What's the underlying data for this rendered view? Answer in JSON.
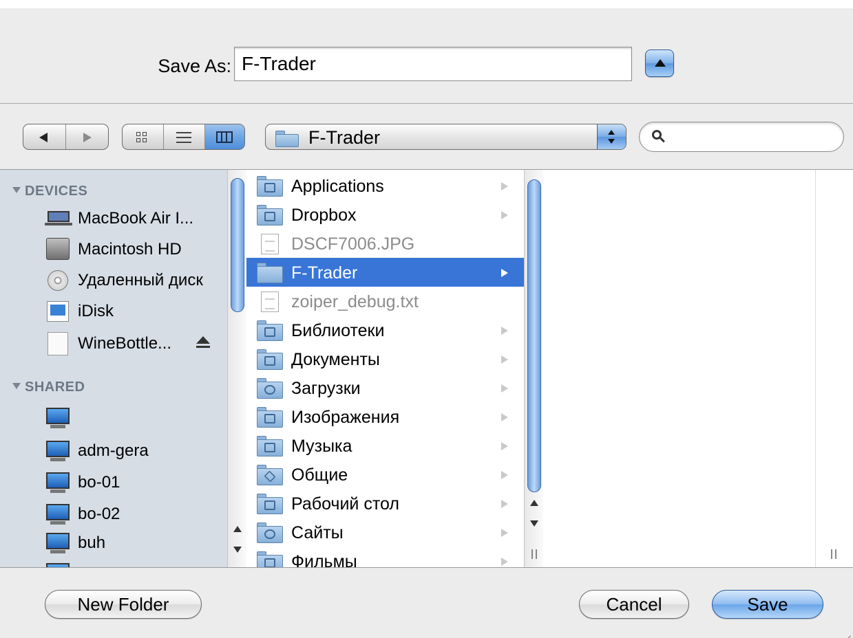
{
  "save_as": {
    "label": "Save As:",
    "value": "F-Trader"
  },
  "toolbar": {
    "back_icon": "back-arrow-icon",
    "forward_icon": "forward-arrow-icon",
    "views": [
      "icon-view-icon",
      "list-view-icon",
      "column-view-icon"
    ],
    "active_view": "column",
    "path": "F-Trader",
    "search_placeholder": ""
  },
  "sidebar": {
    "devices_header": "DEVICES",
    "devices": [
      {
        "label": "MacBook Air I...",
        "icon": "laptop-icon"
      },
      {
        "label": "Macintosh HD",
        "icon": "hard-disk-icon"
      },
      {
        "label": "Удаленный диск",
        "icon": "optical-disc-icon"
      },
      {
        "label": "iDisk",
        "icon": "idisk-icon"
      },
      {
        "label": "WineBottle...",
        "icon": "disk-image-icon",
        "ejectable": true
      }
    ],
    "shared_header": "SHARED",
    "shared": [
      {
        "label": "",
        "icon": "network-computer-icon"
      },
      {
        "label": "adm-gera",
        "icon": "network-computer-icon"
      },
      {
        "label": "bo-01",
        "icon": "network-computer-icon"
      },
      {
        "label": "bo-02",
        "icon": "network-computer-icon"
      },
      {
        "label": "buh",
        "icon": "network-computer-icon"
      }
    ]
  },
  "files": [
    {
      "name": "Applications",
      "kind": "folder",
      "icon": "applications-folder-icon"
    },
    {
      "name": "Dropbox",
      "kind": "folder",
      "icon": "dropbox-folder-icon"
    },
    {
      "name": "DSCF7006.JPG",
      "kind": "file",
      "dimmed": true,
      "icon": "image-file-icon"
    },
    {
      "name": "F-Trader",
      "kind": "folder",
      "selected": true,
      "icon": "folder-icon"
    },
    {
      "name": "zoiper_debug.txt",
      "kind": "file",
      "dimmed": true,
      "icon": "text-file-icon"
    },
    {
      "name": "Библиотеки",
      "kind": "folder",
      "icon": "library-folder-icon"
    },
    {
      "name": "Документы",
      "kind": "folder",
      "icon": "documents-folder-icon"
    },
    {
      "name": "Загрузки",
      "kind": "folder",
      "icon": "downloads-folder-icon"
    },
    {
      "name": "Изображения",
      "kind": "folder",
      "icon": "pictures-folder-icon"
    },
    {
      "name": "Музыка",
      "kind": "folder",
      "icon": "music-folder-icon"
    },
    {
      "name": "Общие",
      "kind": "folder",
      "icon": "public-folder-icon"
    },
    {
      "name": "Рабочий стол",
      "kind": "folder",
      "icon": "desktop-folder-icon"
    },
    {
      "name": "Сайты",
      "kind": "folder",
      "icon": "sites-folder-icon"
    },
    {
      "name": "Фильмы",
      "kind": "folder",
      "icon": "movies-folder-icon"
    }
  ],
  "buttons": {
    "new_folder": "New Folder",
    "cancel": "Cancel",
    "save": "Save"
  },
  "colors": {
    "selection": "#3875d7",
    "sidebar_bg": "#d6dde5",
    "accent_button": "#6aa5ea"
  }
}
